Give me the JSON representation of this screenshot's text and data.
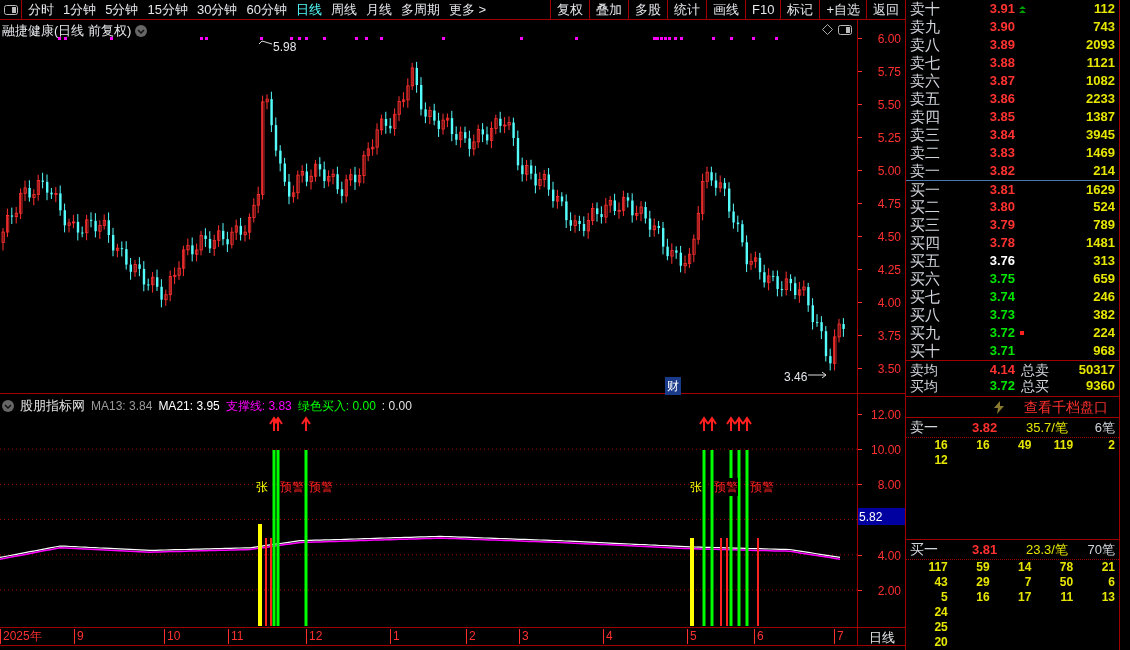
{
  "toolbar": {
    "tabs": [
      {
        "label": "分时",
        "selected": false
      },
      {
        "label": "1分钟",
        "selected": false
      },
      {
        "label": "5分钟",
        "selected": false
      },
      {
        "label": "15分钟",
        "selected": false
      },
      {
        "label": "30分钟",
        "selected": false
      },
      {
        "label": "60分钟",
        "selected": false
      },
      {
        "label": "日线",
        "selected": true
      },
      {
        "label": "周线",
        "selected": false
      },
      {
        "label": "月线",
        "selected": false
      },
      {
        "label": "多周期",
        "selected": false
      },
      {
        "label": "更多 >",
        "selected": false
      }
    ],
    "buttons": [
      "复权",
      "叠加",
      "多股",
      "统计",
      "画线",
      "F10",
      "标记",
      "+自选",
      "返回"
    ]
  },
  "chart": {
    "title": "融捷健康(日线 前复权)",
    "price_axis": [
      "6.00",
      "5.75",
      "5.50",
      "5.25",
      "5.00",
      "4.75",
      "4.50",
      "4.25",
      "4.00",
      "3.75",
      "3.50"
    ],
    "high_label": "5.98",
    "low_label": "3.46",
    "badge": "财"
  },
  "indicator": {
    "legend": [
      {
        "text": "股朋指标网",
        "color": "#e0e0e0"
      },
      {
        "text": "MA13: 3.84",
        "color": "#9a9a9a"
      },
      {
        "text": "MA21: 3.95",
        "color": "#ffffff"
      },
      {
        "text": "支撑线: 3.83",
        "color": "#ff00ff"
      },
      {
        "text": "绿色买入: 0.00",
        "color": "#00ff00"
      },
      {
        "text": ": 0.00",
        "color": "#e0e0e0"
      }
    ],
    "axis": [
      "12.00",
      "10.00",
      "8.00",
      "4.00",
      "2.00"
    ],
    "current_value": "5.82",
    "signal_labels": [
      {
        "text": "张",
        "kind": "rise"
      },
      {
        "text": "预警",
        "kind": "alert"
      },
      {
        "text": "预警",
        "kind": "alert"
      },
      {
        "text": "张",
        "kind": "rise"
      },
      {
        "text": "预警",
        "kind": "alert"
      },
      {
        "text": "预警",
        "kind": "alert"
      }
    ]
  },
  "date_axis": {
    "labels": [
      "2025年",
      "9",
      "10",
      "11",
      "12",
      "1",
      "2",
      "3",
      "4",
      "5",
      "6",
      "7"
    ],
    "period": "日线"
  },
  "order_book": {
    "levels": [
      {
        "label": "卖十",
        "price": "3.91",
        "volume": "112",
        "color": "#ff3232",
        "up_arrow": true,
        "dot_marker": false
      },
      {
        "label": "卖九",
        "price": "3.90",
        "volume": "743",
        "color": "#ff3232",
        "up_arrow": false,
        "dot_marker": false
      },
      {
        "label": "卖八",
        "price": "3.89",
        "volume": "2093",
        "color": "#ff3232",
        "up_arrow": false,
        "dot_marker": false
      },
      {
        "label": "卖七",
        "price": "3.88",
        "volume": "1121",
        "color": "#ff3232",
        "up_arrow": false,
        "dot_marker": false
      },
      {
        "label": "卖六",
        "price": "3.87",
        "volume": "1082",
        "color": "#ff3232",
        "up_arrow": false,
        "dot_marker": false
      },
      {
        "label": "卖五",
        "price": "3.86",
        "volume": "2233",
        "color": "#ff3232",
        "up_arrow": false,
        "dot_marker": false
      },
      {
        "label": "卖四",
        "price": "3.85",
        "volume": "1387",
        "color": "#ff3232",
        "up_arrow": false,
        "dot_marker": false
      },
      {
        "label": "卖三",
        "price": "3.84",
        "volume": "3945",
        "color": "#ff3232",
        "up_arrow": false,
        "dot_marker": false
      },
      {
        "label": "卖二",
        "price": "3.83",
        "volume": "1469",
        "color": "#ff3232",
        "up_arrow": false,
        "dot_marker": false
      },
      {
        "label": "卖一",
        "price": "3.82",
        "volume": "214",
        "color": "#ff3232",
        "up_arrow": false,
        "dot_marker": false
      },
      {
        "label": "买一",
        "price": "3.81",
        "volume": "1629",
        "color": "#ff3232",
        "up_arrow": false,
        "dot_marker": false
      },
      {
        "label": "买二",
        "price": "3.80",
        "volume": "524",
        "color": "#ff3232",
        "up_arrow": false,
        "dot_marker": false
      },
      {
        "label": "买三",
        "price": "3.79",
        "volume": "789",
        "color": "#ff3232",
        "up_arrow": false,
        "dot_marker": false
      },
      {
        "label": "买四",
        "price": "3.78",
        "volume": "1481",
        "color": "#ff3232",
        "up_arrow": false,
        "dot_marker": false
      },
      {
        "label": "买五",
        "price": "3.76",
        "volume": "313",
        "color": "#ffffff",
        "up_arrow": false,
        "dot_marker": false
      },
      {
        "label": "买六",
        "price": "3.75",
        "volume": "659",
        "color": "#00e600",
        "up_arrow": false,
        "dot_marker": false
      },
      {
        "label": "买七",
        "price": "3.74",
        "volume": "246",
        "color": "#00e600",
        "up_arrow": false,
        "dot_marker": false
      },
      {
        "label": "买八",
        "price": "3.73",
        "volume": "382",
        "color": "#00e600",
        "up_arrow": false,
        "dot_marker": false
      },
      {
        "label": "买九",
        "price": "3.72",
        "volume": "224",
        "color": "#00e600",
        "up_arrow": false,
        "dot_marker": true
      },
      {
        "label": "买十",
        "price": "3.71",
        "volume": "968",
        "color": "#00e600",
        "up_arrow": false,
        "dot_marker": false
      }
    ],
    "summary": [
      {
        "label": "卖均",
        "price": "4.14",
        "color": "#ff3232",
        "total_label": "总卖",
        "total": "50317"
      },
      {
        "label": "买均",
        "price": "3.72",
        "color": "#00e600",
        "total_label": "总买",
        "total": "9360"
      }
    ],
    "depth_link": "查看千档盘口",
    "queues": [
      {
        "label": "卖一",
        "price": "3.82",
        "average": "35.7/笔",
        "count": "6笔",
        "orders": [
          [
            "16",
            "16",
            "49",
            "119",
            "2"
          ],
          [
            "12"
          ]
        ]
      },
      {
        "label": "买一",
        "price": "3.81",
        "average": "23.3/笔",
        "count": "70笔",
        "orders": [
          [
            "117",
            "59",
            "14",
            "78",
            "21"
          ],
          [
            "43",
            "29",
            "7",
            "50",
            "6"
          ],
          [
            "5",
            "16",
            "17",
            "11",
            "13"
          ],
          [
            "24"
          ],
          [
            "25"
          ],
          [
            "20"
          ]
        ]
      }
    ]
  }
}
